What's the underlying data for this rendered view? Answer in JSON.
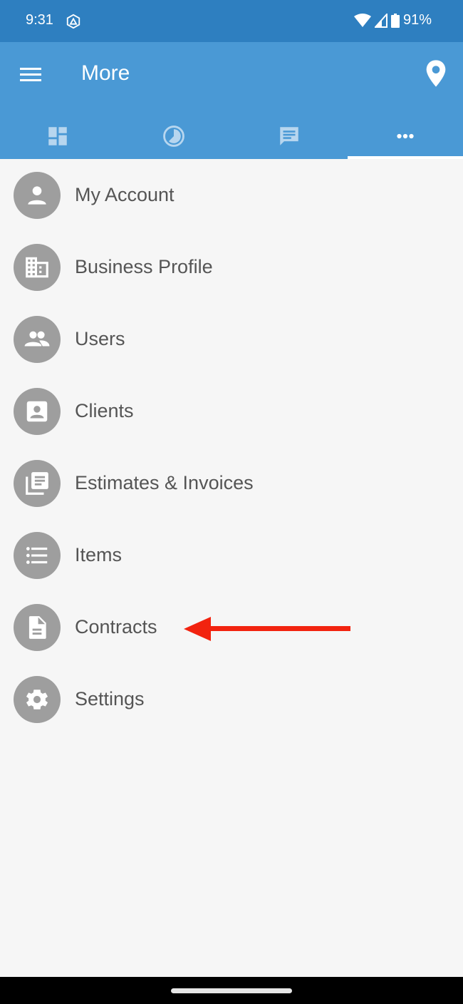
{
  "status_bar": {
    "time": "9:31",
    "app_icon": "drive-triangle-icon",
    "battery": "91%",
    "icons": [
      "wifi-icon",
      "cell-signal-icon",
      "battery-icon"
    ]
  },
  "app_bar": {
    "title": "More",
    "menu_icon": "hamburger-menu-icon",
    "action_icon": "location-pin-icon",
    "colors": {
      "status_bar": "#2e7fc0",
      "app_bar": "#4a99d5",
      "tab_inactive": "#b7d6ef"
    }
  },
  "tabs": [
    {
      "name": "dashboard",
      "icon": "dashboard-icon",
      "active": false
    },
    {
      "name": "timer",
      "icon": "clock-icon",
      "active": false
    },
    {
      "name": "messages",
      "icon": "chat-icon",
      "active": false
    },
    {
      "name": "more",
      "icon": "more-horizontal-icon",
      "active": true
    }
  ],
  "menu_items": [
    {
      "label": "My Account",
      "icon": "person-icon"
    },
    {
      "label": "Business Profile",
      "icon": "building-icon"
    },
    {
      "label": "Users",
      "icon": "group-icon"
    },
    {
      "label": "Clients",
      "icon": "contact-card-icon"
    },
    {
      "label": "Estimates & Invoices",
      "icon": "documents-stack-icon"
    },
    {
      "label": "Items",
      "icon": "list-icon"
    },
    {
      "label": "Contracts",
      "icon": "document-icon"
    },
    {
      "label": "Settings",
      "icon": "gear-icon"
    }
  ],
  "annotation": {
    "type": "arrow",
    "points_to": "Contracts",
    "color": "#f2230f"
  }
}
